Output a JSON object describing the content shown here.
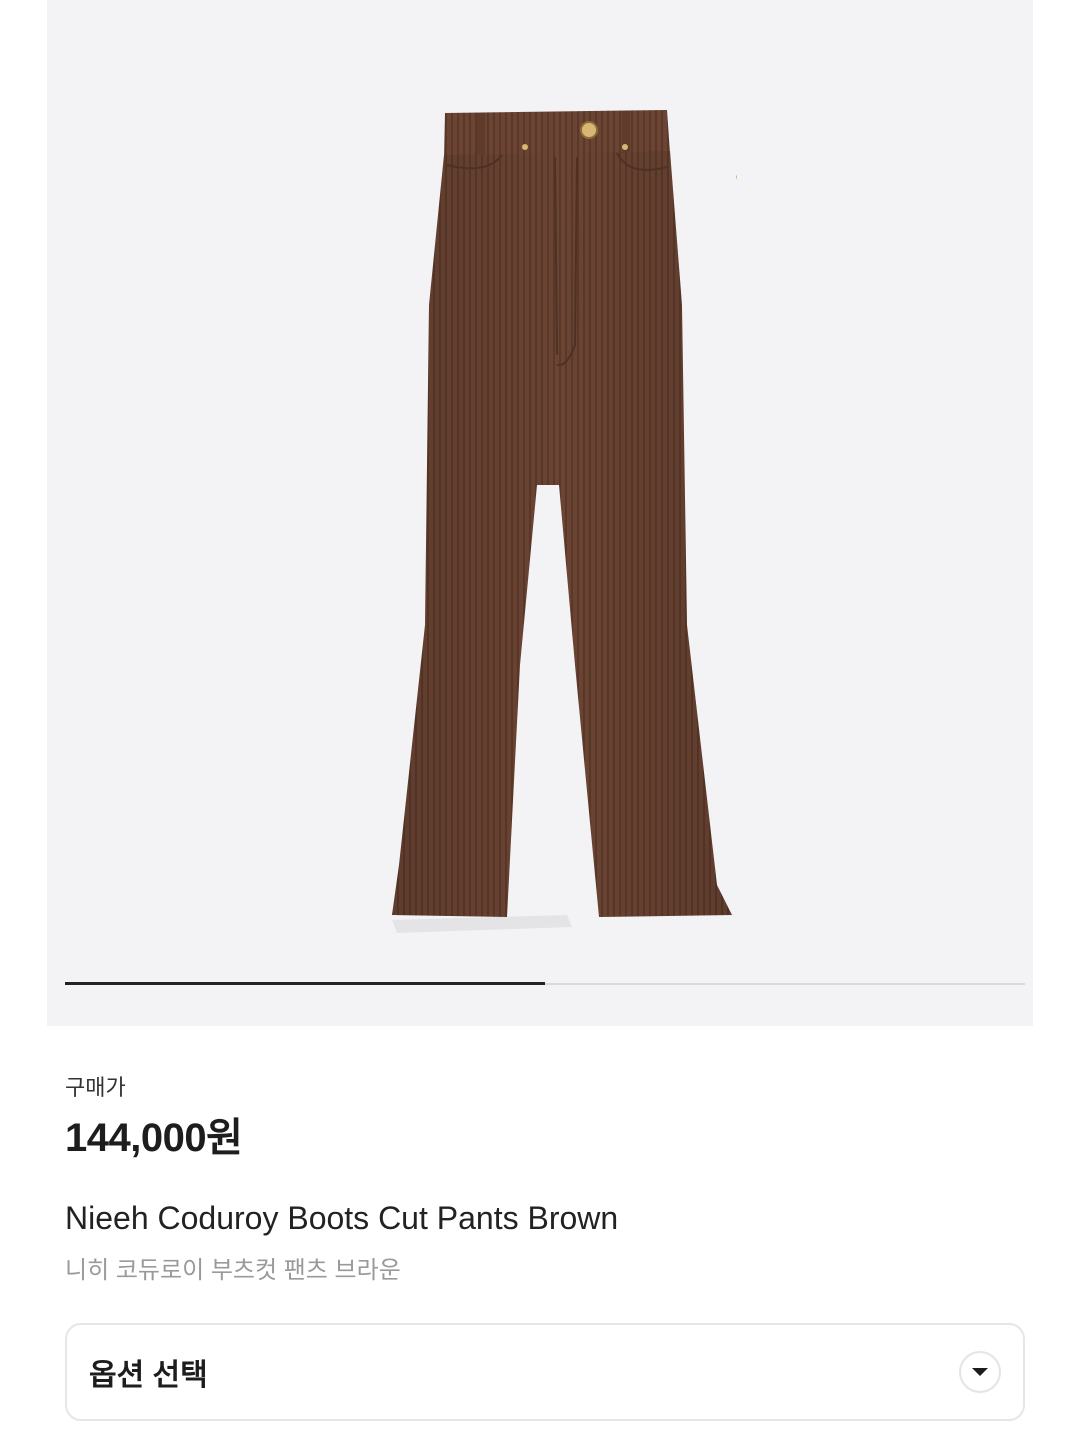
{
  "gallery": {
    "image_alt": "brown corduroy boots cut pants",
    "progress": 0.5,
    "progress_color": "#222222",
    "background": "#f3f3f5"
  },
  "product": {
    "price_label": "구매가",
    "price": "144,000원",
    "name_en": "Nieeh Coduroy Boots Cut Pants Brown",
    "name_ko": "니히 코듀로이 부츠컷 팬츠 브라운",
    "color_swatch": "#6a4331"
  },
  "option": {
    "label": "옵션 선택",
    "icon": "chevron-down-icon"
  }
}
